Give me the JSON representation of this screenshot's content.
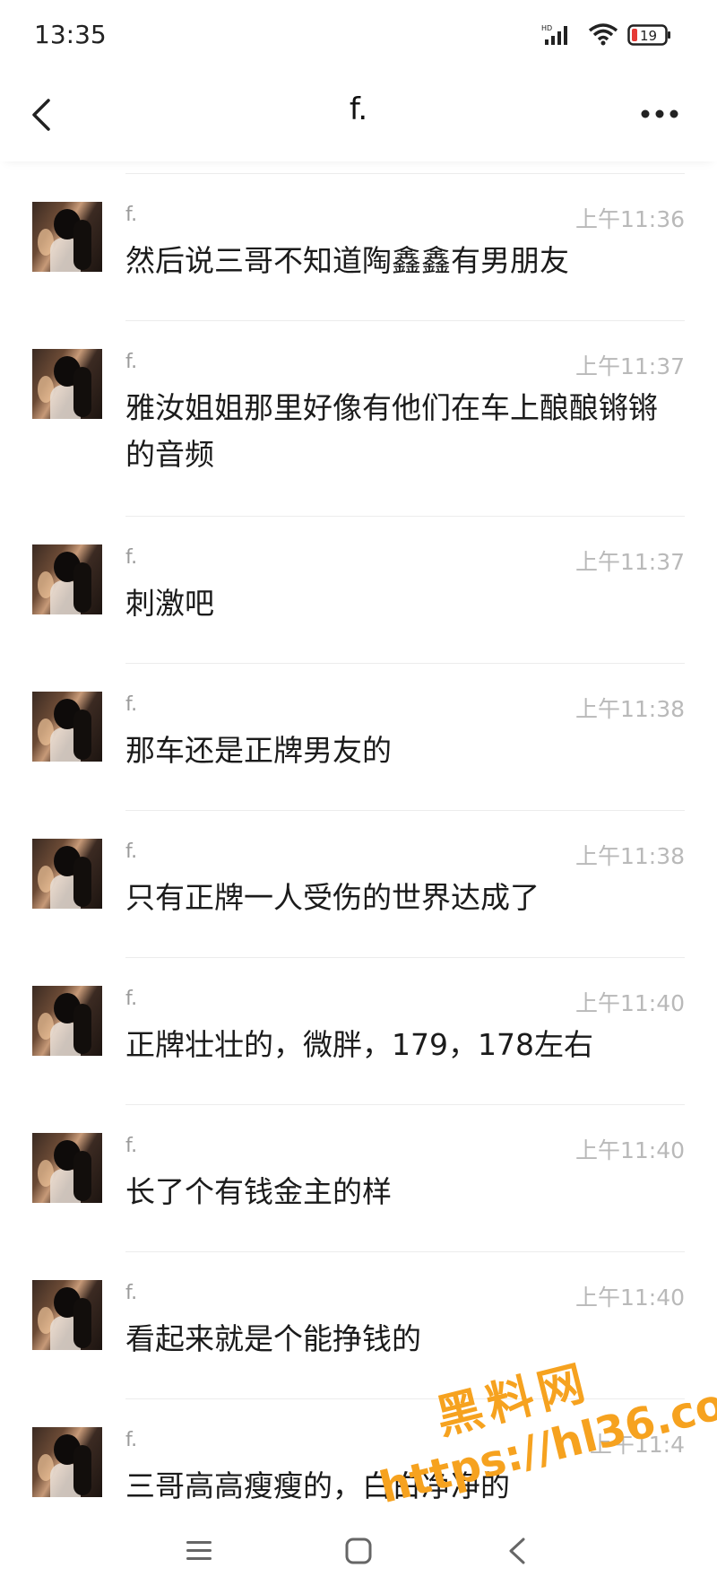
{
  "status_bar": {
    "time": "13:35",
    "battery": "19",
    "network": "HD"
  },
  "header": {
    "title": "f."
  },
  "messages": [
    {
      "name": "f.",
      "time": "上午11:36",
      "text": "然后说三哥不知道陶鑫鑫有男朋友"
    },
    {
      "name": "f.",
      "time": "上午11:37",
      "text": "雅汝姐姐那里好像有他们在车上酿酿锵锵的音频"
    },
    {
      "name": "f.",
      "time": "上午11:37",
      "text": "刺激吧"
    },
    {
      "name": "f.",
      "time": "上午11:38",
      "text": "那车还是正牌男友的"
    },
    {
      "name": "f.",
      "time": "上午11:38",
      "text": "只有正牌一人受伤的世界达成了"
    },
    {
      "name": "f.",
      "time": "上午11:40",
      "text": "正牌壮壮的，微胖，179，178左右"
    },
    {
      "name": "f.",
      "time": "上午11:40",
      "text": "长了个有钱金主的样"
    },
    {
      "name": "f.",
      "time": "上午11:40",
      "text": "看起来就是个能挣钱的"
    },
    {
      "name": "f.",
      "time": "上午11:4",
      "text": "三哥高高瘦瘦的，白白净净的"
    }
  ],
  "watermark": {
    "line1": "黑料网",
    "line2": "https://hl36.co"
  }
}
